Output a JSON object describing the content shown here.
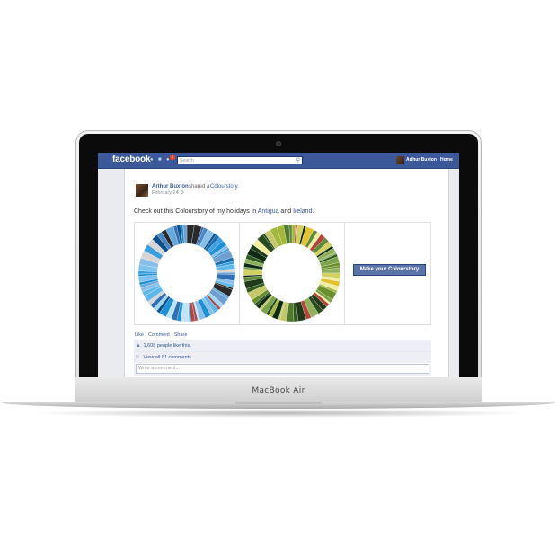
{
  "device": {
    "brand": "MacBook Air"
  },
  "navbar": {
    "logo": "facebook",
    "search_placeholder": "Search",
    "notification_count": "1",
    "user_name": "Arthur Buxton",
    "home_label": "Home"
  },
  "post": {
    "author": "Arthur Buxton",
    "shared_text": "shared a",
    "app_link": "Colourstory.",
    "date": "February 24",
    "text_prefix": "Check out this Colourstory of my holidays in ",
    "link1": "Antigua",
    "text_and": " and ",
    "link2": "Ireland",
    "text_suffix": ".",
    "button_label": "Make your Colourstory"
  },
  "ufi": {
    "like": "Like",
    "comment": "Comment",
    "share": "Share",
    "likes_text": "1,608 people like this.",
    "view_comments": "View all 81 comments",
    "comment_placeholder": "Write a comment..."
  },
  "colors": {
    "facebook_blue": "#3b5998",
    "antigua_palette": [
      "#1e90d6",
      "#5fb8ea",
      "#9fd6f2",
      "#2f6fb4",
      "#0d4f8b",
      "#7ec3ef",
      "#3ca0de",
      "#bfe4f7",
      "#1a6fb0",
      "#63a9dc",
      "#2a2a2a",
      "#d6d6d6",
      "#a94a4a",
      "#6d9fd0",
      "#4a86c5",
      "#88bfe8"
    ],
    "ireland_palette": [
      "#2f5a1e",
      "#6b8f2a",
      "#a3b83a",
      "#1e3a18",
      "#4f7a2c",
      "#d2d060",
      "#0f2a12",
      "#7aa34a",
      "#c3c96a",
      "#3d5f24",
      "#e3c230",
      "#b3443a",
      "#5e8a3a",
      "#2a4a1f",
      "#8db05a",
      "#f2eea0"
    ]
  }
}
